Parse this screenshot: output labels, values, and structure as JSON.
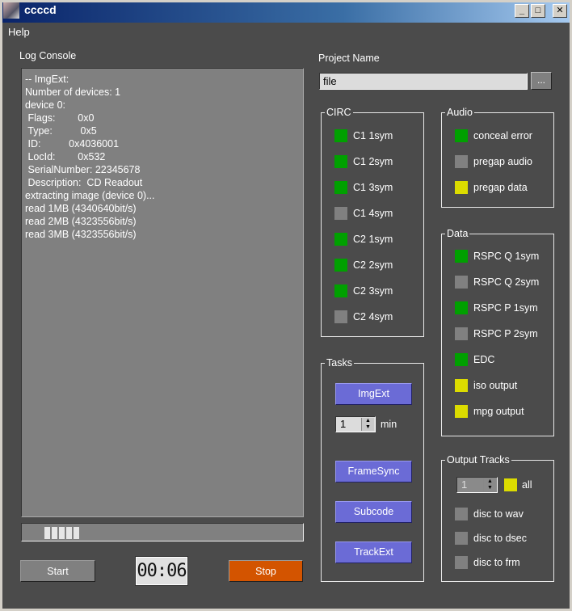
{
  "window": {
    "title": "ccccd",
    "min": "_",
    "max": "□",
    "close": "✕"
  },
  "menu": {
    "help": "Help"
  },
  "log": {
    "label": "Log Console",
    "lines": [
      "-- ImgExt:",
      "Number of devices: 1",
      "device 0:",
      " Flags:        0x0",
      " Type:          0x5",
      " ID:          0x4036001",
      " LocId:        0x532",
      " SerialNumber: 22345678",
      " Description:  CD Readout",
      "extracting image (device 0)...",
      "read 1MB (4340640bit/s)",
      "read 2MB (4323556bit/s)",
      "read 3MB (4323556bit/s)"
    ]
  },
  "progress": {
    "segments_filled": 5
  },
  "controls": {
    "start": "Start",
    "timer": "00:06",
    "stop": "Stop"
  },
  "project": {
    "label": "Project Name",
    "value": "file",
    "browse": "..."
  },
  "colors": {
    "green": "#00a000",
    "gray": "#808080",
    "yellow": "#dcdc00",
    "stop": "#d35400",
    "task": "#6b6bd6"
  },
  "circ": {
    "title": "CIRC",
    "items": [
      {
        "label": "C1 1sym",
        "state": "g"
      },
      {
        "label": "C1 2sym",
        "state": "g"
      },
      {
        "label": "C1 3sym",
        "state": "g"
      },
      {
        "label": "C1 4sym",
        "state": "x"
      },
      {
        "label": "C2 1sym",
        "state": "g"
      },
      {
        "label": "C2 2sym",
        "state": "g"
      },
      {
        "label": "C2 3sym",
        "state": "g"
      },
      {
        "label": "C2 4sym",
        "state": "x"
      }
    ]
  },
  "audio": {
    "title": "Audio",
    "items": [
      {
        "label": "conceal error",
        "state": "g"
      },
      {
        "label": "pregap audio",
        "state": "x"
      },
      {
        "label": "pregap data",
        "state": "y"
      }
    ]
  },
  "data": {
    "title": "Data",
    "items": [
      {
        "label": "RSPC Q 1sym",
        "state": "g"
      },
      {
        "label": "RSPC Q 2sym",
        "state": "x"
      },
      {
        "label": "RSPC P 1sym",
        "state": "g"
      },
      {
        "label": "RSPC P 2sym",
        "state": "x"
      },
      {
        "label": "EDC",
        "state": "g"
      },
      {
        "label": "iso output",
        "state": "y"
      },
      {
        "label": "mpg output",
        "state": "y"
      }
    ]
  },
  "tasks": {
    "title": "Tasks",
    "imgext": "ImgExt",
    "minutes": "1",
    "min_label": "min",
    "framesync": "FrameSync",
    "subcode": "Subcode",
    "trackext": "TrackExt"
  },
  "output": {
    "title": "Output Tracks",
    "track": "1",
    "all": "all",
    "items": [
      {
        "label": "disc to wav",
        "state": "x"
      },
      {
        "label": "disc to dsec",
        "state": "x"
      },
      {
        "label": "disc to frm",
        "state": "x"
      }
    ]
  }
}
